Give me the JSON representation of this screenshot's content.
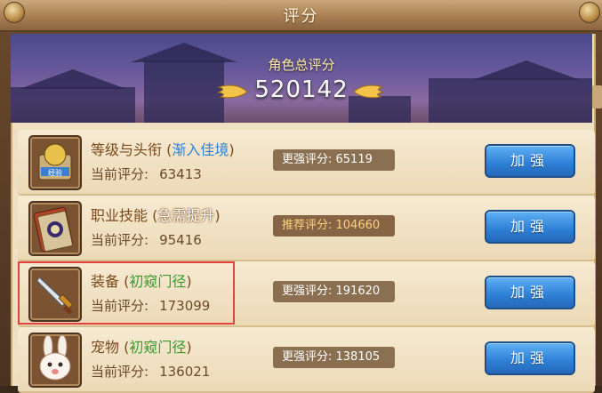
{
  "window": {
    "title": "评分"
  },
  "banner": {
    "label": "角色总评分",
    "total_score": "520142"
  },
  "rows": [
    {
      "name": "等级与头衔",
      "tag_open": " (",
      "tag": "渐入佳境",
      "tag_close": ")",
      "tag_color": "blue",
      "score_label": "当前评分:",
      "score": "63413",
      "badge": "更强评分: 65119",
      "button": "加强",
      "icon_caption": "经验"
    },
    {
      "name": "职业技能",
      "tag_open": " (",
      "tag": "急需提升",
      "tag_close": ")",
      "tag_color": "white",
      "score_label": "当前评分:",
      "score": "95416",
      "badge": "推荐评分: 104660",
      "button": "加强"
    },
    {
      "name": "装备",
      "tag_open": " (",
      "tag": "初窥门径",
      "tag_close": ")",
      "tag_color": "green",
      "score_label": "当前评分:",
      "score": "173099",
      "badge": "更强评分: 191620",
      "button": "加强",
      "highlighted": true
    },
    {
      "name": "宠物",
      "tag_open": " (",
      "tag": "初窥门径",
      "tag_close": ")",
      "tag_color": "green",
      "score_label": "当前评分:",
      "score": "136021",
      "badge": "更强评分: 138105",
      "button": "加强"
    }
  ],
  "colors": {
    "button_blue": "#2d7fd6",
    "tag_blue": "#2f7fd6",
    "tag_green": "#3a9a30",
    "highlight_red": "#e0443e",
    "recommend_gold": "#ffd27a"
  },
  "icons": [
    "level-badge-icon",
    "skill-book-icon",
    "sword-icon",
    "rabbit-pet-icon",
    "wing-left-icon",
    "wing-right-icon"
  ]
}
